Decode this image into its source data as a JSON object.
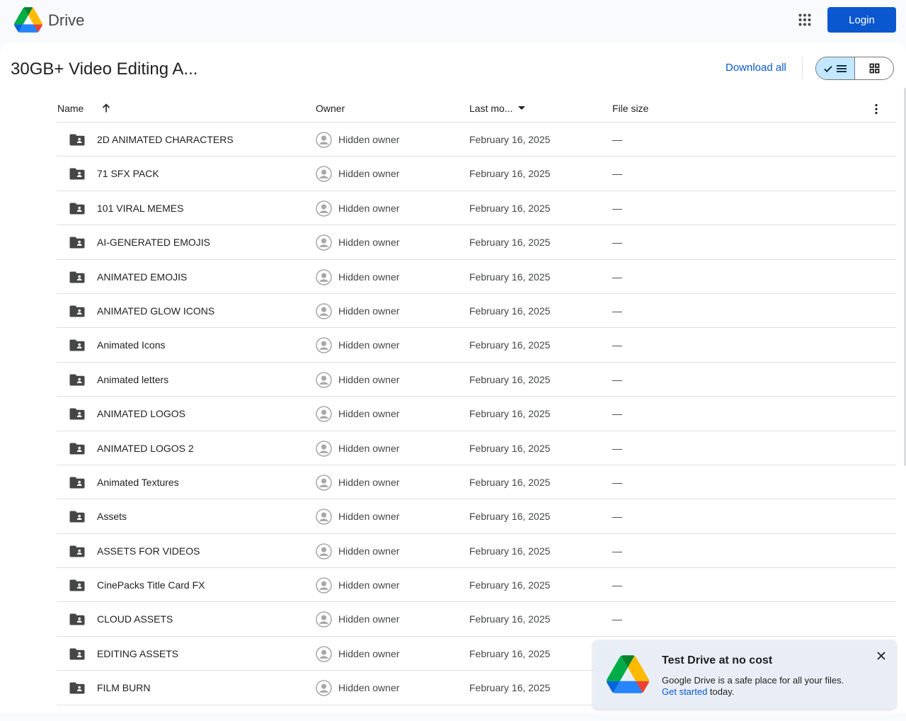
{
  "app": {
    "brand": "Drive",
    "login_label": "Login"
  },
  "folder": {
    "title": "30GB+ Video Editing A...",
    "download_all_label": "Download all"
  },
  "table": {
    "columns": {
      "name": "Name",
      "owner": "Owner",
      "modified": "Last mo...",
      "size": "File size"
    },
    "rows": [
      {
        "name": "2D ANIMATED CHARACTERS",
        "owner": "Hidden owner",
        "modified": "February 16, 2025",
        "size": "—"
      },
      {
        "name": "71 SFX PACK",
        "owner": "Hidden owner",
        "modified": "February 16, 2025",
        "size": "—"
      },
      {
        "name": "101 VIRAL MEMES",
        "owner": "Hidden owner",
        "modified": "February 16, 2025",
        "size": "—"
      },
      {
        "name": "AI-GENERATED EMOJIS",
        "owner": "Hidden owner",
        "modified": "February 16, 2025",
        "size": "—"
      },
      {
        "name": "ANIMATED EMOJIS",
        "owner": "Hidden owner",
        "modified": "February 16, 2025",
        "size": "—"
      },
      {
        "name": "ANIMATED GLOW ICONS",
        "owner": "Hidden owner",
        "modified": "February 16, 2025",
        "size": "—"
      },
      {
        "name": "Animated Icons",
        "owner": "Hidden owner",
        "modified": "February 16, 2025",
        "size": "—"
      },
      {
        "name": "Animated letters",
        "owner": "Hidden owner",
        "modified": "February 16, 2025",
        "size": "—"
      },
      {
        "name": "ANIMATED LOGOS",
        "owner": "Hidden owner",
        "modified": "February 16, 2025",
        "size": "—"
      },
      {
        "name": "ANIMATED LOGOS 2",
        "owner": "Hidden owner",
        "modified": "February 16, 2025",
        "size": "—"
      },
      {
        "name": "Animated Textures",
        "owner": "Hidden owner",
        "modified": "February 16, 2025",
        "size": "—"
      },
      {
        "name": "Assets",
        "owner": "Hidden owner",
        "modified": "February 16, 2025",
        "size": "—"
      },
      {
        "name": "ASSETS FOR VIDEOS",
        "owner": "Hidden owner",
        "modified": "February 16, 2025",
        "size": "—"
      },
      {
        "name": "CinePacks Title Card FX",
        "owner": "Hidden owner",
        "modified": "February 16, 2025",
        "size": "—"
      },
      {
        "name": "CLOUD ASSETS",
        "owner": "Hidden owner",
        "modified": "February 16, 2025",
        "size": "—"
      },
      {
        "name": "EDITING ASSETS",
        "owner": "Hidden owner",
        "modified": "February 16, 2025",
        "size": ""
      },
      {
        "name": "FILM BURN",
        "owner": "Hidden owner",
        "modified": "February 16, 2025",
        "size": ""
      }
    ]
  },
  "promo": {
    "title": "Test Drive at no cost",
    "body": "Google Drive is a safe place for all your files.",
    "link": "Get started",
    "suffix": " today."
  },
  "icons": {
    "logo": "google-drive-logo",
    "apps": "apps-grid-icon",
    "sort": "arrow-up-icon",
    "more": "more-vert-icon",
    "folder": "shared-folder-icon",
    "avatar": "account-circle-icon",
    "close": "close-icon",
    "list_view": "list-view-icon",
    "grid_view": "grid-view-icon",
    "check": "check-icon"
  },
  "colors": {
    "accent": "#0b57d0",
    "toggle_active": "#c2e7ff",
    "background": "#f8fafd"
  }
}
